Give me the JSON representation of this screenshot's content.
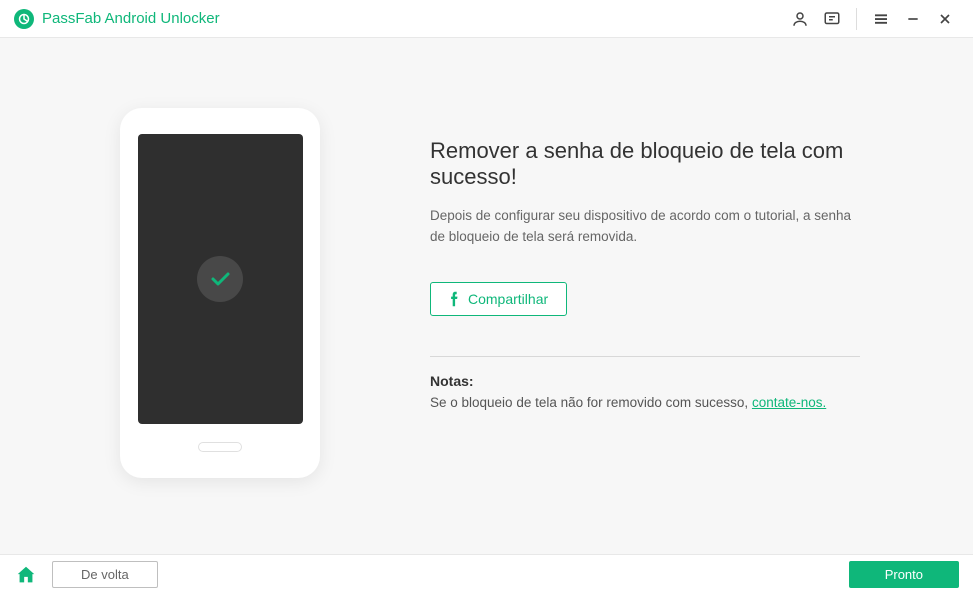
{
  "brand": "PassFab Android Unlocker",
  "main": {
    "heading": "Remover a senha de bloqueio de tela com sucesso!",
    "description": "Depois de configurar seu dispositivo de acordo com o tutorial, a senha de bloqueio de tela será removida.",
    "share_label": "Compartilhar",
    "notes_label": "Notas:",
    "notes_text": "Se o bloqueio de tela não for removido com sucesso, ",
    "contact_link": "contate-nos."
  },
  "footer": {
    "back_label": "De volta",
    "done_label": "Pronto"
  },
  "colors": {
    "accent": "#0fb77a"
  }
}
